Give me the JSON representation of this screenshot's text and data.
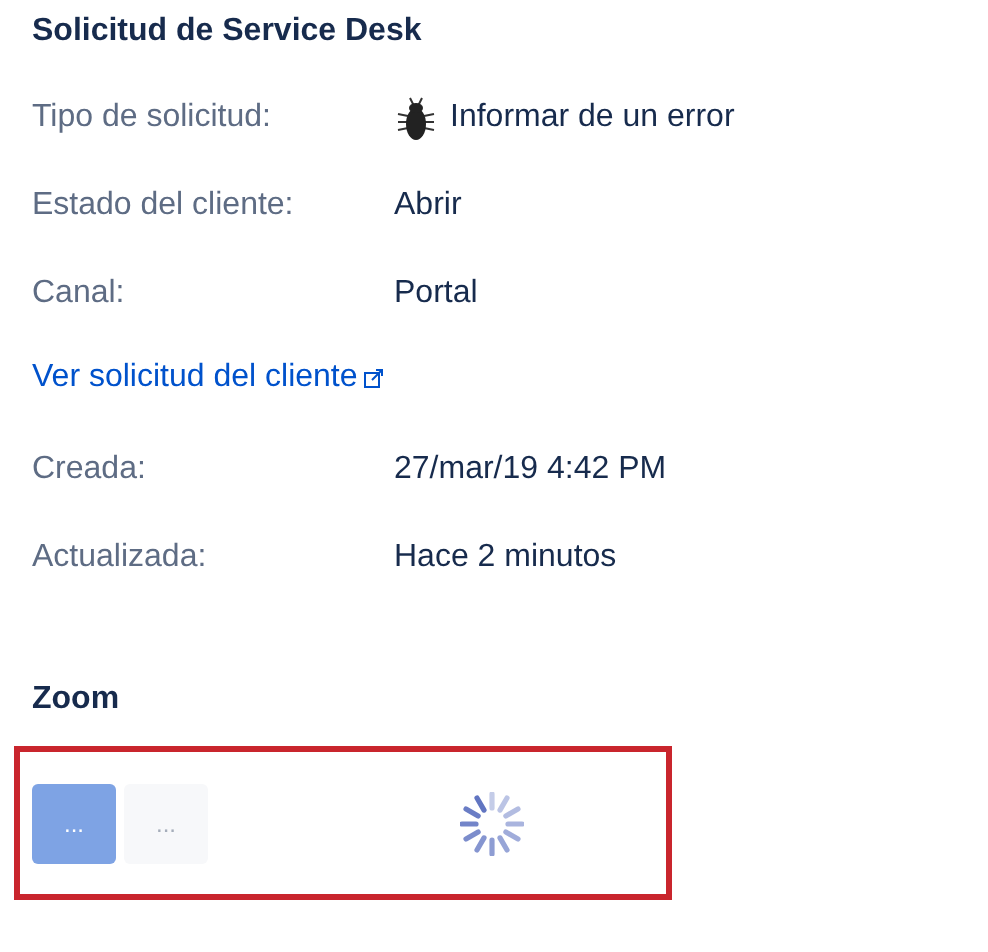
{
  "request_section": {
    "title": "Solicitud de Service Desk",
    "fields": [
      {
        "label": "Tipo de solicitud:",
        "value": "Informar de un error",
        "kind": "bug"
      },
      {
        "label": "Estado del cliente:",
        "value": "Abrir",
        "kind": "text"
      },
      {
        "label": "Canal:",
        "value": "Portal",
        "kind": "text"
      }
    ],
    "link": "Ver solicitud del cliente",
    "dates": [
      {
        "label": "Creada:",
        "value": "27/mar/19 4:42 PM"
      },
      {
        "label": "Actualizada:",
        "value": "Hace 2 minutos"
      }
    ]
  },
  "zoom_section": {
    "title": "Zoom",
    "buttons": [
      {
        "label": "...",
        "kind": "primary"
      },
      {
        "label": "...",
        "kind": "subtle"
      }
    ],
    "loading": true
  }
}
